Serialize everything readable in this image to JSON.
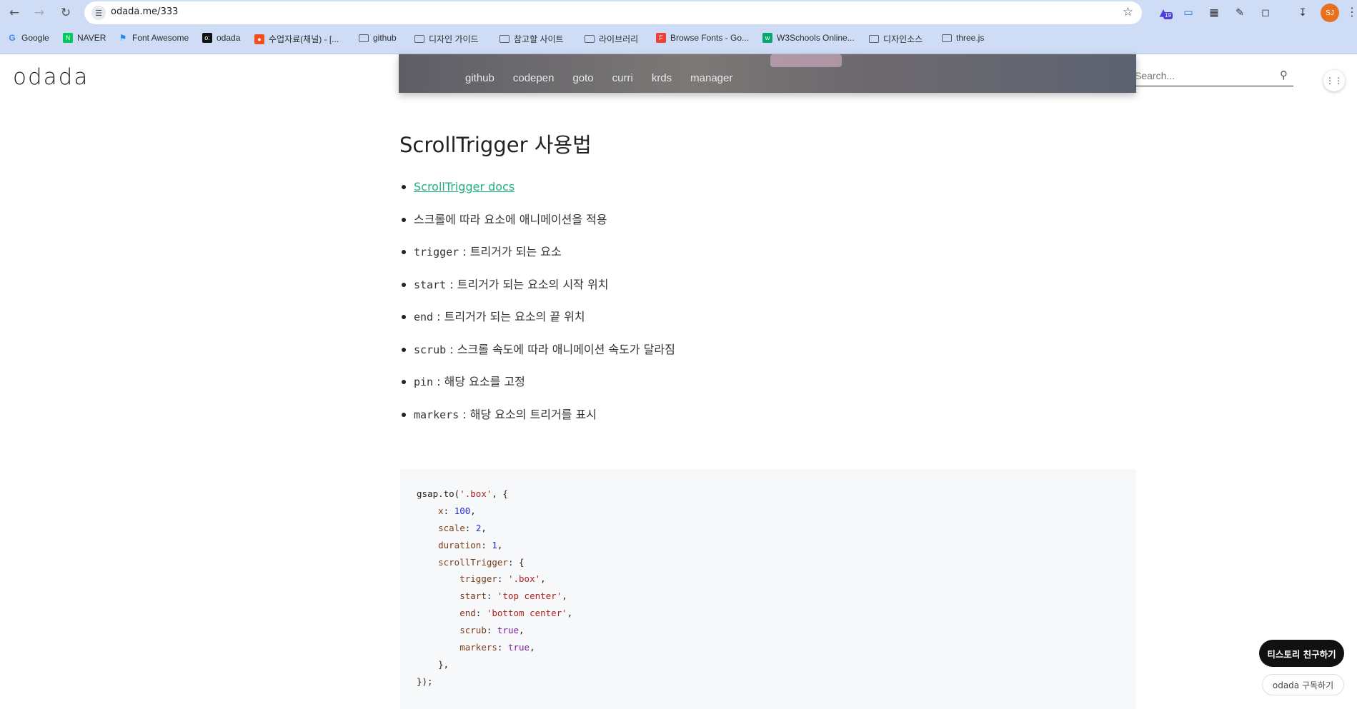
{
  "browser": {
    "url": "odada.me/333",
    "extension_badge": "19",
    "profile_initials": "SJ"
  },
  "bookmarks": [
    {
      "label": "Google",
      "icon": "google-icon",
      "color": "#4285f4"
    },
    {
      "label": "NAVER",
      "icon": "naver-icon",
      "color": "#03c75a"
    },
    {
      "label": "Font Awesome",
      "icon": "flag-icon",
      "color": "#228ae6"
    },
    {
      "label": "odada",
      "icon": "odada-icon",
      "color": "#111111"
    },
    {
      "label": "수업자료(채널) - [...",
      "icon": "figma-icon",
      "color": "#f24e1e"
    },
    {
      "label": "github",
      "icon": "folder-icon"
    },
    {
      "label": "디자인 가이드",
      "icon": "folder-icon"
    },
    {
      "label": "참고할 사이트",
      "icon": "folder-icon"
    },
    {
      "label": "라이브러리",
      "icon": "folder-icon"
    },
    {
      "label": "Browse Fonts - Go...",
      "icon": "google-fonts-icon",
      "color": "#ea4335"
    },
    {
      "label": "W3Schools Online...",
      "icon": "w3schools-icon",
      "color": "#04aa6d"
    },
    {
      "label": "디자인소스",
      "icon": "folder-icon"
    },
    {
      "label": "three.js",
      "icon": "folder-icon"
    }
  ],
  "site": {
    "logo": "odada",
    "nav": [
      "github",
      "codepen",
      "goto",
      "curri",
      "krds",
      "manager"
    ],
    "search_placeholder": "Search..."
  },
  "post": {
    "title": "ScrollTrigger 사용법",
    "link_text": "ScrollTrigger docs",
    "items": [
      {
        "code": "",
        "text": "스크롤에 따라 요소에 애니메이션을 적용"
      },
      {
        "code": "trigger",
        "text": " : 트리거가 되는 요소"
      },
      {
        "code": "start",
        "text": " : 트리거가 되는 요소의 시작 위치"
      },
      {
        "code": "end",
        "text": " : 트리거가 되는 요소의 끝 위치"
      },
      {
        "code": "scrub",
        "text": " : 스크롤 속도에 따라 애니메이션 속도가 달라짐"
      },
      {
        "code": "pin",
        "text": " : 해당 요소를 고정"
      },
      {
        "code": "markers",
        "text": " : 해당 요소의 트리거를 표시"
      }
    ]
  },
  "code": [
    "gsap.to('.box', {",
    "    x: 100,",
    "    scale: 2,",
    "    duration: 1,",
    "    scrollTrigger: {",
    "        trigger: '.box',",
    "        start: 'top center',",
    "        end: 'bottom center',",
    "        scrub: true,",
    "        markers: true,",
    "    },",
    "});"
  ],
  "floating": {
    "friend_button": "티스토리 친구하기",
    "subscribe_button": "odada 구독하기"
  },
  "colors": {
    "link": "#21ae84",
    "chrome": "#cfdcf5",
    "code_bg": "#f7f8fa"
  }
}
